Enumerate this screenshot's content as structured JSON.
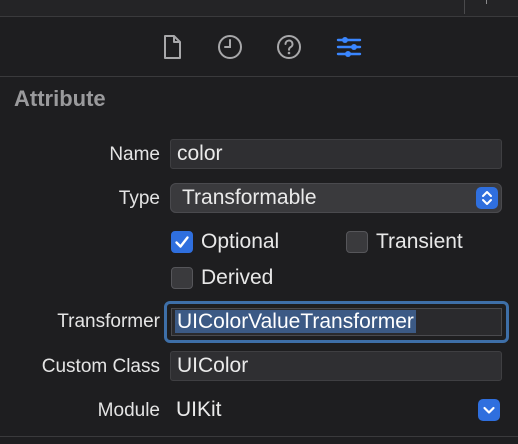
{
  "tabs": [
    {
      "name": "file-inspector",
      "icon": "document-icon",
      "active": false
    },
    {
      "name": "history-inspector",
      "icon": "clock-icon",
      "active": false
    },
    {
      "name": "quick-help",
      "icon": "question-icon",
      "active": false
    },
    {
      "name": "attributes-inspector",
      "icon": "sliders-icon",
      "active": true
    }
  ],
  "section": {
    "title": "Attribute"
  },
  "fields": {
    "name_label": "Name",
    "name_value": "color",
    "type_label": "Type",
    "type_value": "Transformable",
    "optional_label": "Optional",
    "optional_checked": true,
    "transient_label": "Transient",
    "transient_checked": false,
    "derived_label": "Derived",
    "derived_checked": false,
    "transformer_label": "Transformer",
    "transformer_value": "UIColorValueTransformer",
    "custom_class_label": "Custom Class",
    "custom_class_value": "UIColor",
    "module_label": "Module",
    "module_value": "UIKit"
  },
  "colors": {
    "accent": "#2f6fde",
    "focus_ring": "#3e6fa8",
    "background": "#1e1e20"
  }
}
